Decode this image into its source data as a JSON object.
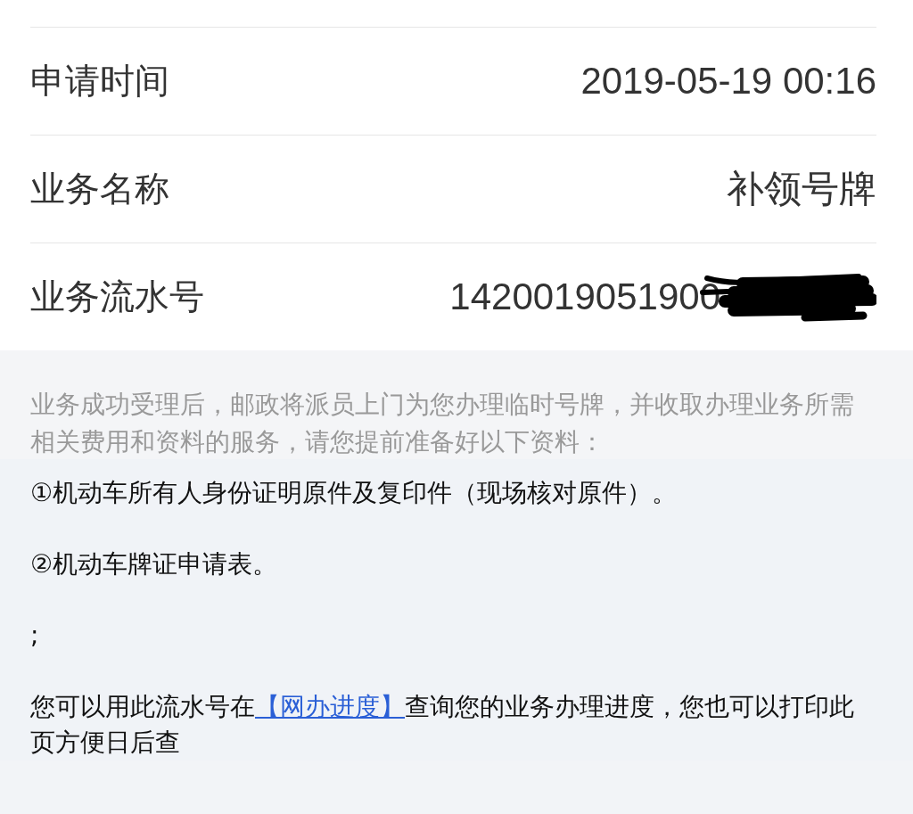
{
  "fields": [
    {
      "label": "申请时间",
      "value": "2019-05-19 00:16",
      "kind": "text"
    },
    {
      "label": "业务名称",
      "value": "补领号牌",
      "kind": "text"
    },
    {
      "label": "业务流水号",
      "value": "1420019051900",
      "kind": "redacted"
    }
  ],
  "notice": "业务成功受理后，邮政将派员上门为您办理临时号牌，并收取办理业务所需相关费用和资料的服务，请您提前准备好以下资料：",
  "materials": [
    "①机动车所有人身份证明原件及复印件（现场核对原件）。",
    "②机动车牌证申请表。",
    ";"
  ],
  "footer": {
    "before": "您可以用此流水号在",
    "link": "【网办进度】",
    "after": "查询您的业务办理进度，您也可以打印此页方便日后查"
  }
}
